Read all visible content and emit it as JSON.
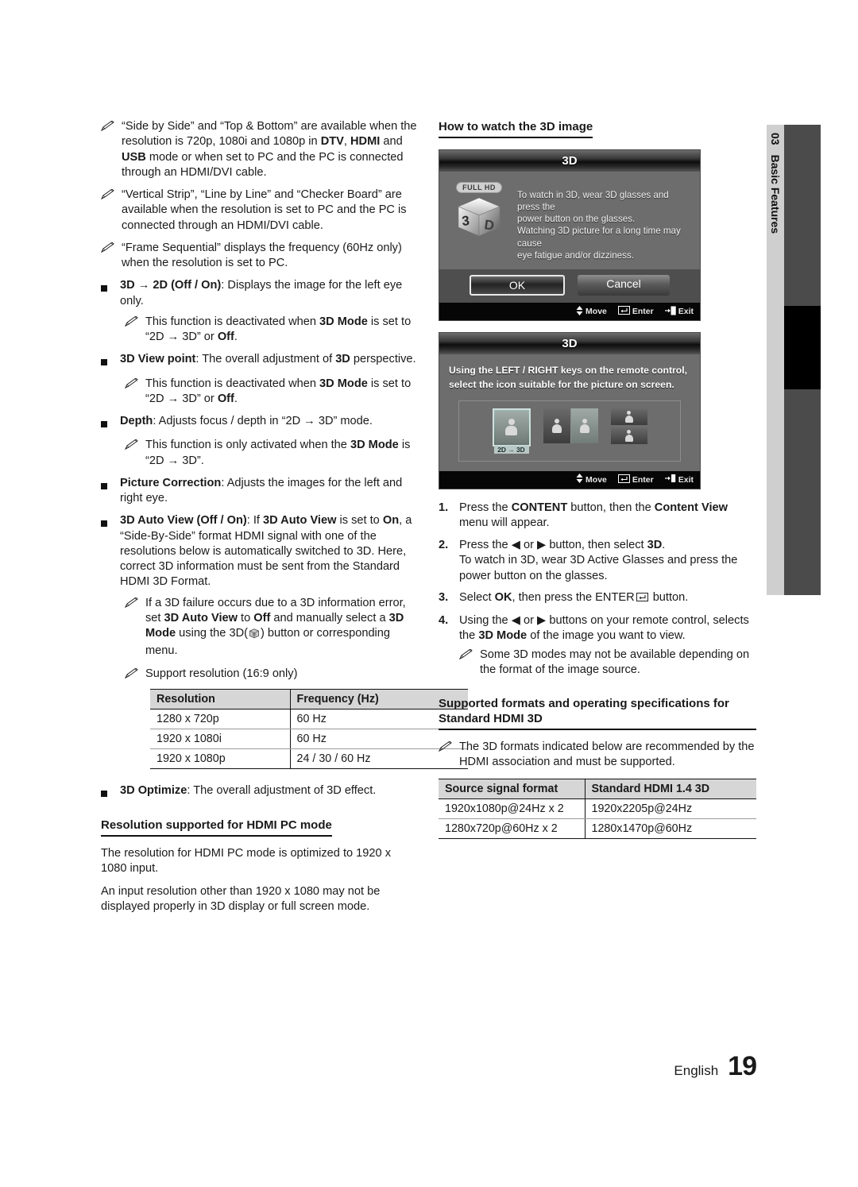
{
  "sidebar": {
    "chapter_number": "03",
    "chapter_title": "Basic Features"
  },
  "footer": {
    "language": "English",
    "page_number": "19"
  },
  "left_column": {
    "notes_top": [
      "“Side by Side” and “Top & Bottom” are available when the resolution is 720p, 1080i and 1080p in DTV, HDMI and USB mode or when set to PC and the PC is connected through an HDMI/DVI cable.",
      "“Vertical Strip”, “Line by Line” and “Checker Board” are available when the resolution is set to PC and the PC is connected through an HDMI/DVI cable.",
      "“Frame Sequential” displays the frequency (60Hz only) when the resolution is set to PC."
    ],
    "item_3d_to_2d": "3D → 2D (Off / On): Displays the image for the left eye only.",
    "note_3d_to_2d": "This function is deactivated when 3D Mode is set to “2D → 3D” or Off.",
    "item_viewpoint": "3D View point: The overall adjustment of 3D perspective.",
    "note_viewpoint": "This function is deactivated when 3D Mode is set to “2D → 3D” or Off.",
    "item_depth": "Depth: Adjusts focus / depth in “2D → 3D” mode.",
    "note_depth": "This function is only activated when the 3D Mode is “2D → 3D”.",
    "item_picture_correction": "Picture Correction: Adjusts the images for the left and right eye.",
    "item_auto_view": "3D Auto View (Off / On): If 3D Auto View is set to On, a “Side-By-Side” format HDMI signal with one of the resolutions below is automatically switched to 3D. Here, correct 3D information must be sent from the Standard HDMI 3D Format.",
    "note_auto_view": "If a 3D failure occurs due to a 3D information error, set 3D Auto View to Off and manually select a 3D Mode using the 3D( ) button or corresponding menu.",
    "note_support_resolution": "Support resolution (16:9 only)",
    "resolution_table": {
      "headers": [
        "Resolution",
        "Frequency (Hz)"
      ],
      "rows": [
        [
          "1280 x 720p",
          "60 Hz"
        ],
        [
          "1920 x 1080i",
          "60 Hz"
        ],
        [
          "1920 x 1080p",
          "24 / 30 / 60 Hz"
        ]
      ]
    },
    "item_optimize": "3D Optimize: The overall adjustment of 3D effect.",
    "heading_hdmi_pc": "Resolution supported for HDMI PC mode",
    "para_hdmi_pc_1": "The resolution for HDMI PC mode is optimized to 1920 x 1080 input.",
    "para_hdmi_pc_2": "An input resolution other than 1920 x 1080 may not be displayed properly in 3D display or full screen mode."
  },
  "right_column": {
    "heading_how_to_watch": "How to watch the 3D image",
    "tv_screen_1": {
      "title": "3D",
      "badge": "FULL HD",
      "logo": "3D",
      "message_line_1": "To watch in 3D, wear 3D glasses and press the",
      "message_line_2": "power button on the glasses.",
      "message_line_3": "Watching 3D picture for a long time may cause",
      "message_line_4": "eye fatigue and/or dizziness.",
      "ok_label": "OK",
      "cancel_label": "Cancel",
      "footer_move": "Move",
      "footer_enter": "Enter",
      "footer_exit": "Exit"
    },
    "tv_screen_2": {
      "title": "3D",
      "message_line_1": "Using the LEFT / RIGHT keys on the remote control,",
      "message_line_2": "select the icon suitable for the picture on screen.",
      "icon_1_label": "2D → 3D",
      "footer_move": "Move",
      "footer_enter": "Enter",
      "footer_exit": "Exit"
    },
    "steps": [
      {
        "n": "1.",
        "text": "Press the CONTENT button, then the Content View menu will appear."
      },
      {
        "n": "2.",
        "text": "Press the ◀ or ▶ button, then select 3D. To watch in 3D, wear 3D Active Glasses and press the power button on the glasses."
      },
      {
        "n": "3.",
        "text": "Select OK, then press the ENTER button."
      },
      {
        "n": "4.",
        "text": "Using the ◀ or ▶ buttons on your remote control, selects the 3D Mode of the image you want to view."
      }
    ],
    "note_step4": "Some 3D modes may not be available depending on the format of the image source.",
    "heading_supported_formats": "Supported formats and operating specifications for Standard HDMI 3D",
    "note_supported_formats": "The 3D formats indicated below are recommended by the HDMI association and must be supported.",
    "format_table": {
      "headers": [
        "Source signal format",
        "Standard HDMI 1.4 3D"
      ],
      "rows": [
        [
          "1920x1080p@24Hz x 2",
          "1920x2205p@24Hz"
        ],
        [
          "1280x720p@60Hz x 2",
          "1280x1470p@60Hz"
        ]
      ]
    }
  }
}
